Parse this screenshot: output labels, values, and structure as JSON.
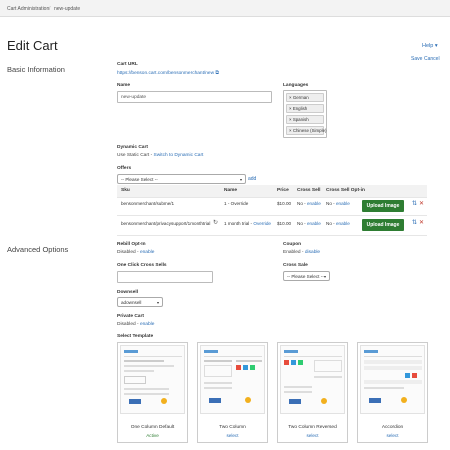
{
  "breadcrumb": {
    "root": "Cart Administration",
    "current": "new-update"
  },
  "header": {
    "title": "Edit Cart",
    "help": "Help",
    "save": "Save",
    "cancel": "Cancel"
  },
  "basic": {
    "section_title": "Basic Information",
    "cart_url_label": "Cart URL",
    "cart_url": "https://benson.cart.com/bensonmerchant/new",
    "name_label": "Name",
    "name_value": "new-update",
    "languages_label": "Languages",
    "languages": [
      "German",
      "English",
      "Spanish",
      "Chinese (Simple)"
    ],
    "dynamic_cart_label": "Dynamic Cart",
    "dynamic_cart_text": "Use Static Cart -",
    "dynamic_cart_link": "Switch to Dynamic Cart",
    "offers_label": "Offers",
    "offers_select": "-- Please Select --",
    "offers_add": "add"
  },
  "offers_table": {
    "headers": [
      "Sku",
      "Name",
      "Price",
      "Cross Sell",
      "Cross Sell Opt-in"
    ],
    "rows": [
      {
        "sku": "bensonmerchant/subme/1",
        "name": "1 - Override",
        "name_link": "",
        "price": "$10.00",
        "cross_sell": "No -",
        "cross_sell_link": "enable",
        "optin": "No -",
        "optin_link": "enable",
        "upload": "Upload Image"
      },
      {
        "sku": "bensonmerchant/privacysupport/1monthtrial",
        "name": "1 month trial -",
        "name_link": "Override",
        "price": "$10.00",
        "cross_sell": "No -",
        "cross_sell_link": "enable",
        "optin": "No -",
        "optin_link": "enable",
        "upload": "Upload Image"
      }
    ]
  },
  "advanced": {
    "section_title": "Advanced Options",
    "rebill_label": "Rebill Opt-In",
    "rebill_text": "Disabled -",
    "rebill_link": "enable",
    "coupon_label": "Coupon",
    "coupon_text": "Enabled -",
    "coupon_link": "disable",
    "ocxs_label": "One Click Cross Sells",
    "cross_sale_label": "Cross Sale",
    "cross_sale_select": "-- Please Select --",
    "downsell_label": "Downsell",
    "downsell_value": "adownsell",
    "private_label": "Private Cart",
    "private_text": "Disabled -",
    "private_link": "enable",
    "template_label": "Select Template"
  },
  "templates": [
    {
      "name": "One Column Default",
      "action": "Active"
    },
    {
      "name": "Two Column",
      "action": "select"
    },
    {
      "name": "Two Column Reversed",
      "action": "select"
    },
    {
      "name": "Accordion",
      "action": "select"
    }
  ],
  "colors": {
    "accent": "#2a6db5",
    "button": "#2e7d32",
    "active": "#2e7d32"
  }
}
